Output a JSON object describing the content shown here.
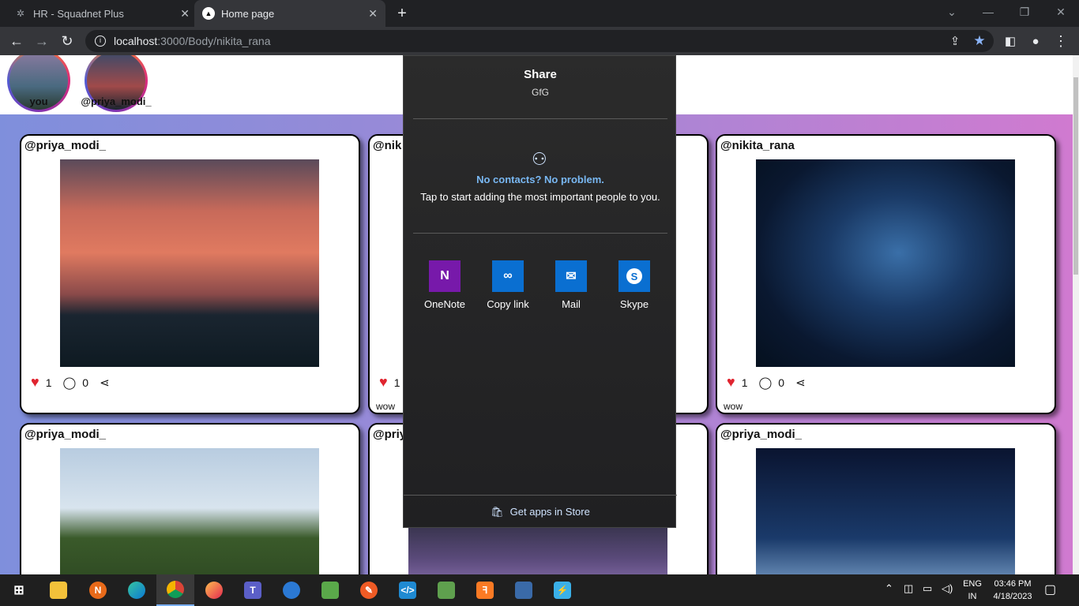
{
  "browser": {
    "tabs": [
      {
        "title": "HR - Squadnet Plus",
        "icon": "squadnet-favicon"
      },
      {
        "title": "Home page",
        "icon": "triangle-favicon"
      }
    ],
    "new_tab": "+",
    "close": "✕",
    "url_host": "localhost",
    "url_path": ":3000/Body/nikita_rana"
  },
  "stories": [
    {
      "label": "you"
    },
    {
      "label": "@priya_modi_"
    }
  ],
  "posts": [
    {
      "user": "@priya_modi_",
      "likes": "1",
      "comments": "0",
      "caption": "",
      "image": "sunset-power-lines"
    },
    {
      "user": "@nik",
      "likes": "1",
      "comments": "",
      "caption": "wow",
      "image": "hidden"
    },
    {
      "user": "@nikita_rana",
      "likes": "1",
      "comments": "0",
      "caption": "wow",
      "image": "starry-space"
    },
    {
      "user": "@priya_modi_",
      "image": "tree-landscape"
    },
    {
      "user": "@priy",
      "image": "mountain-lake"
    },
    {
      "user": "@priya_modi_",
      "image": "night-tree"
    }
  ],
  "share": {
    "title": "Share",
    "subtitle": "GfG",
    "no_contacts": "No contacts? No problem.",
    "tap_hint": "Tap to start adding the most important people to you.",
    "apps": [
      {
        "label": "OneNote",
        "color": "#7719aa",
        "icon": "onenote-icon"
      },
      {
        "label": "Copy link",
        "color": "#0a6fd1",
        "icon": "link-icon"
      },
      {
        "label": "Mail",
        "color": "#0a6fd1",
        "icon": "mail-icon"
      },
      {
        "label": "Skype",
        "color": "#0a6fd1",
        "icon": "skype-icon"
      }
    ],
    "store": "Get apps in Store"
  },
  "tray": {
    "lang_top": "ENG",
    "lang_bottom": "IN",
    "time": "03:46 PM",
    "date": "4/18/2023"
  }
}
